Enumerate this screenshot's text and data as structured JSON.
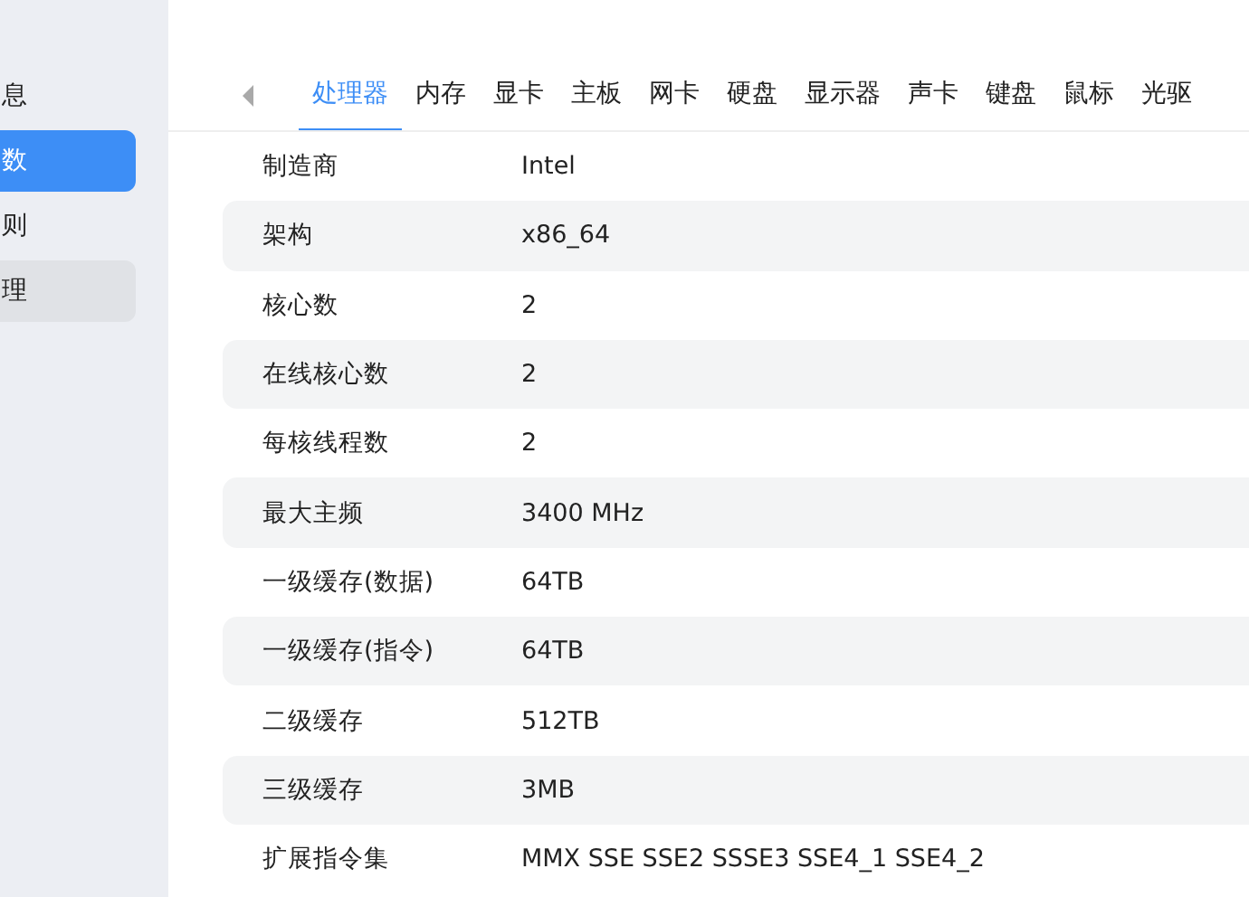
{
  "sidebar": {
    "items": [
      {
        "label": "息",
        "selected": false,
        "hovered": false
      },
      {
        "label": "数",
        "selected": true,
        "hovered": false
      },
      {
        "label": "则",
        "selected": false,
        "hovered": false
      },
      {
        "label": "理",
        "selected": false,
        "hovered": true
      }
    ]
  },
  "tabs": [
    {
      "label": "处理器",
      "selected": true
    },
    {
      "label": "内存",
      "selected": false
    },
    {
      "label": "显卡",
      "selected": false
    },
    {
      "label": "主板",
      "selected": false
    },
    {
      "label": "网卡",
      "selected": false
    },
    {
      "label": "硬盘",
      "selected": false
    },
    {
      "label": "显示器",
      "selected": false
    },
    {
      "label": "声卡",
      "selected": false
    },
    {
      "label": "键盘",
      "selected": false
    },
    {
      "label": "鼠标",
      "selected": false
    },
    {
      "label": "光驱",
      "selected": false
    }
  ],
  "properties": [
    {
      "name": "制造商",
      "value": "Intel"
    },
    {
      "name": "架构",
      "value": "x86_64"
    },
    {
      "name": "核心数",
      "value": "2"
    },
    {
      "name": "在线核心数",
      "value": "2"
    },
    {
      "name": "每核线程数",
      "value": "2"
    },
    {
      "name": "最大主频",
      "value": "3400 MHz"
    },
    {
      "name": "一级缓存(数据)",
      "value": "64TB"
    },
    {
      "name": "一级缓存(指令)",
      "value": "64TB"
    },
    {
      "name": "二级缓存",
      "value": "512TB"
    },
    {
      "name": "三级缓存",
      "value": "3MB"
    },
    {
      "name": "扩展指令集",
      "value": "MMX SSE SSE2 SSSE3 SSE4_1 SSE4_2"
    }
  ]
}
